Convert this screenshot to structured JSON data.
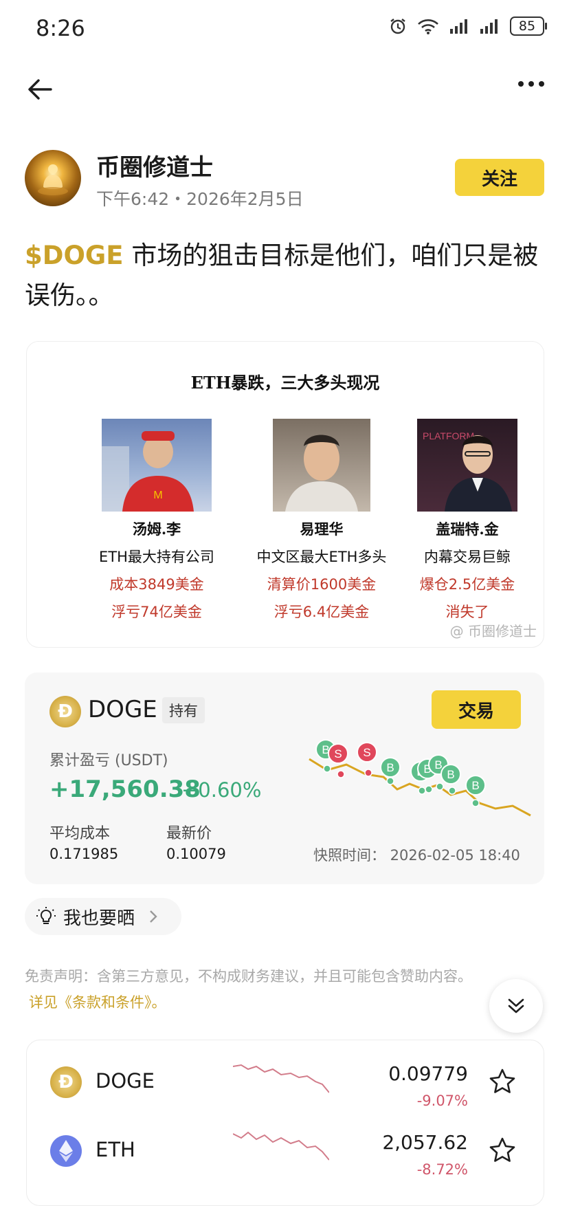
{
  "status_bar": {
    "time": "8:26",
    "battery": "85"
  },
  "author": {
    "name": "币圈修道士",
    "time": "下午6:42・2026年2月5日",
    "follow_label": "关注"
  },
  "post": {
    "cashtag": "$DOGE",
    "text": " 市场的狙击目标是他们，咱们只是被误伤。。"
  },
  "image": {
    "title": "ETH暴跌，三大多头现况",
    "people": [
      {
        "name": "汤姆.李",
        "desc": "ETH最大持有公司",
        "line1": "成本3849美金",
        "line2": "浮亏74亿美金"
      },
      {
        "name": "易理华",
        "desc": "中文区最大ETH多头",
        "line1": "清算价1600美金",
        "line2": "浮亏6.4亿美金"
      },
      {
        "name": "盖瑞特.金",
        "desc": "内幕交易巨鲸",
        "line1": "爆仓2.5亿美金",
        "line2": "消失了"
      }
    ],
    "watermark": "@ 币圈修道士"
  },
  "position": {
    "symbol": "DOGE",
    "hold_tag": "持有",
    "trade_label": "交易",
    "pnl_label": "累计盈亏 (USDT)",
    "pnl_value": "+17,560.38",
    "pnl_pct": "+0.60%",
    "avg_cost_label": "平均成本",
    "avg_cost_value": "0.171985",
    "last_price_label": "最新价",
    "last_price_value": "0.10079",
    "snapshot": "快照时间： 2026-02-05 18:40",
    "markers": [
      "B",
      "S",
      "S",
      "B",
      "B",
      "B",
      "B",
      "B",
      "B"
    ]
  },
  "share": {
    "label": "我也要晒"
  },
  "disclaimer": {
    "text": "免责声明：含第三方意见，不构成财务建议，并且可能包含赞助内容。",
    "link": "详见《条款和条件》。"
  },
  "market": [
    {
      "symbol": "DOGE",
      "price": "0.09779",
      "change": "-9.07%"
    },
    {
      "symbol": "ETH",
      "price": "2,057.62",
      "change": "-8.72%"
    }
  ],
  "colors": {
    "accent_yellow": "#f4d23b",
    "gain_green": "#3aa979",
    "loss_red": "#d0566a",
    "buy_green": "#5dbf8a",
    "sell_red": "#e0475b"
  }
}
